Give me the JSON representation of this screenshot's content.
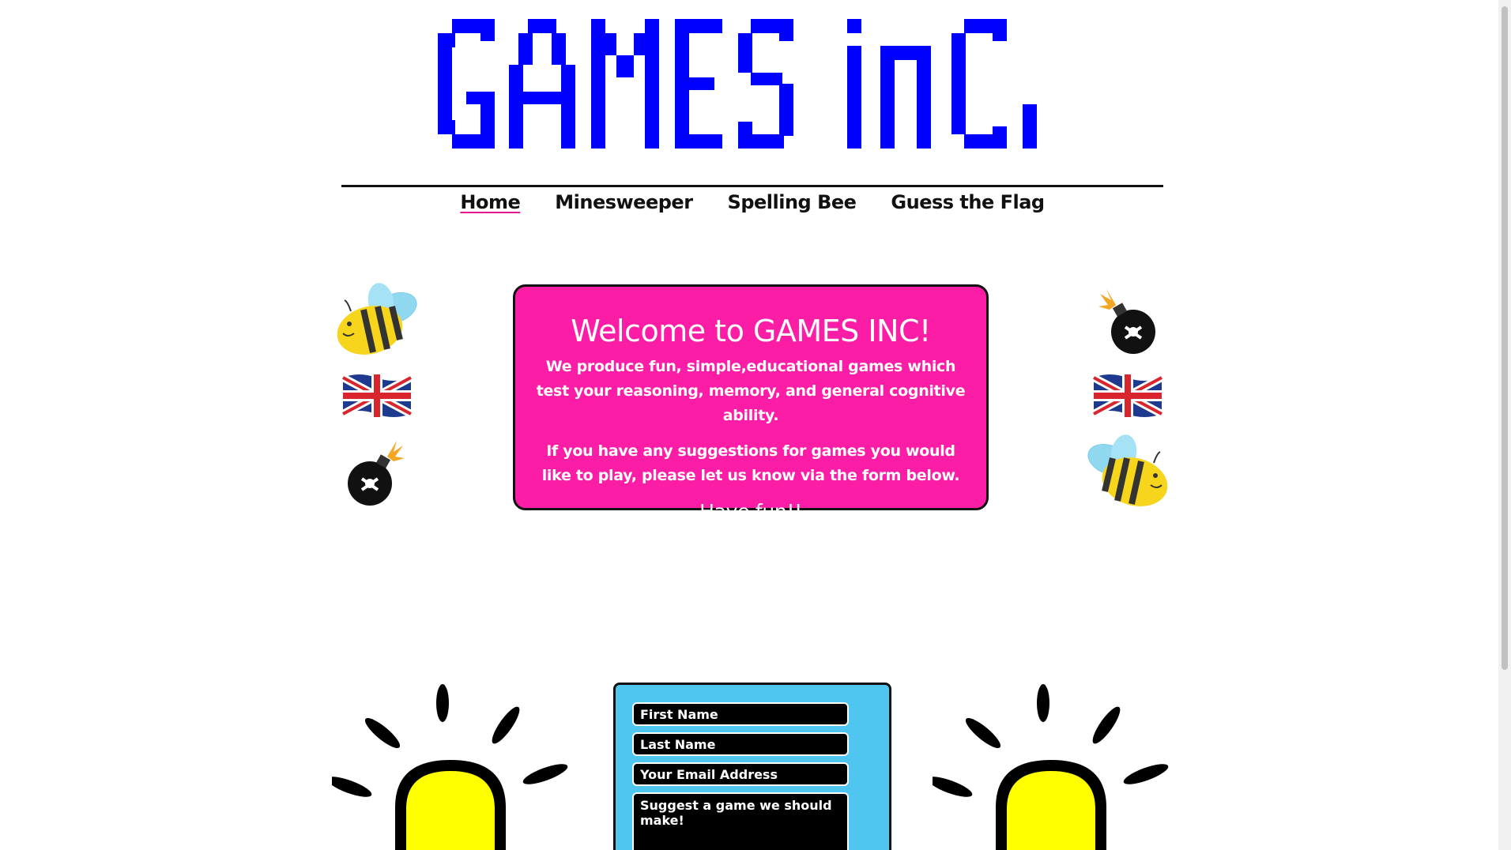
{
  "site": {
    "logo_text": "GAMES INC."
  },
  "nav": {
    "items": [
      {
        "label": "Home",
        "active": true
      },
      {
        "label": "Minesweeper",
        "active": false
      },
      {
        "label": "Spelling Bee",
        "active": false
      },
      {
        "label": "Guess the Flag",
        "active": false
      }
    ]
  },
  "welcome": {
    "title": "Welcome to GAMES INC!",
    "paragraph1": "We produce fun, simple,educational games which test your reasoning, memory, and general cognitive ability.",
    "paragraph2": "If you have any suggestions for games you would like to play, please let us know via the form below.",
    "closing": "Have fun!!"
  },
  "form": {
    "first_name_placeholder": "First Name",
    "last_name_placeholder": "Last Name",
    "email_placeholder": "Your Email Address",
    "suggestion_placeholder": "Suggest a game we should make!"
  },
  "colors": {
    "logo_blue": "#0000ff",
    "welcome_pink": "#fb1da6",
    "form_blue": "#4fc6f0",
    "bulb_yellow": "#ffff00",
    "active_underline": "#e8158c"
  },
  "icons": {
    "left_column": [
      "bee-icon",
      "union-jack-flag-icon",
      "bomb-icon"
    ],
    "right_column": [
      "bomb-icon",
      "union-jack-flag-icon",
      "bee-icon"
    ],
    "bulbs": [
      "lightbulb-icon",
      "lightbulb-icon"
    ]
  }
}
